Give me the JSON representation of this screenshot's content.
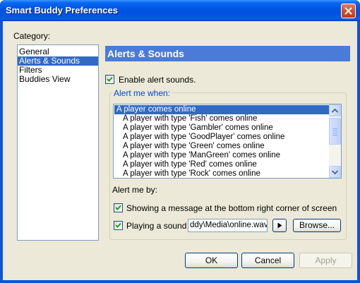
{
  "window": {
    "title": "Smart Buddy Preferences"
  },
  "category": {
    "label": "Category:",
    "items": [
      {
        "label": "General",
        "selected": false
      },
      {
        "label": "Alerts & Sounds",
        "selected": true
      },
      {
        "label": "Filters",
        "selected": false
      },
      {
        "label": "Buddies View",
        "selected": false
      }
    ]
  },
  "section": {
    "title": "Alerts & Sounds"
  },
  "enable_alerts": {
    "label": "Enable alert sounds.",
    "checked": true
  },
  "alert_when": {
    "label": "Alert me when:",
    "items": [
      {
        "label": "A player comes online",
        "selected": true
      },
      {
        "label": "A player with type 'Fish'  comes online",
        "selected": false
      },
      {
        "label": "A player with type 'Gambler'  comes online",
        "selected": false
      },
      {
        "label": "A player with type 'GoodPlayer'  comes online",
        "selected": false
      },
      {
        "label": "A player with type 'Green'  comes online",
        "selected": false
      },
      {
        "label": "A player with type 'ManGreen'  comes online",
        "selected": false
      },
      {
        "label": "A player with type 'Red'  comes online",
        "selected": false
      },
      {
        "label": "A player with type 'Rock'  comes online",
        "selected": false
      }
    ]
  },
  "alert_by": {
    "label": "Alert me by:",
    "show_message": {
      "label": "Showing a message at the bottom right corner of screen",
      "checked": true
    },
    "play_sound": {
      "label": "Playing a sound",
      "checked": true,
      "file_value": "ddy\\Media\\online.wav",
      "browse_label": "Browse..."
    }
  },
  "buttons": {
    "ok": "OK",
    "cancel": "Cancel",
    "apply": "Apply"
  },
  "icons": {
    "close": "close-icon",
    "play": "play-icon",
    "check": "checkmark-icon",
    "scroll_up": "scroll-up-arrow-icon",
    "scroll_down": "scroll-down-arrow-icon"
  },
  "colors": {
    "title_bar": "#0054e3",
    "selection": "#316ac5",
    "section_header": "#4a7bd8",
    "group_title": "#0046d5",
    "dialog_bg": "#ece9d8"
  }
}
